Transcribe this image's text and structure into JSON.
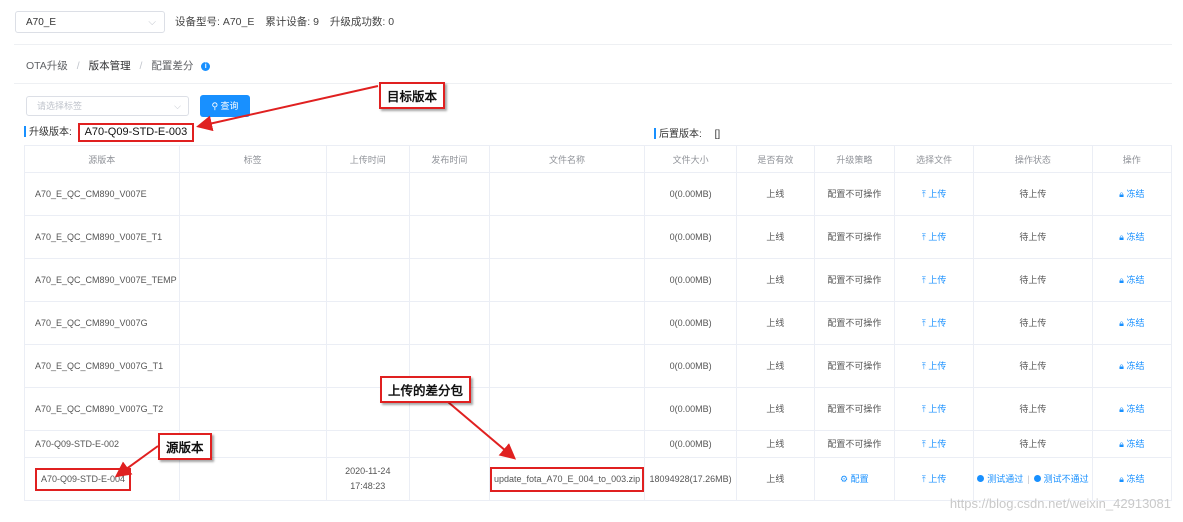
{
  "topbar": {
    "device_select": "A70_E",
    "device_model": "设备型号: A70_E",
    "total_devices": "累计设备: 9",
    "upgrade_success": "升级成功数: 0"
  },
  "breadcrumb": [
    "OTA升级",
    "版本管理",
    "配置差分"
  ],
  "filter": {
    "tag_placeholder": "请选择标签",
    "query_label": "查询"
  },
  "upgrade_version": {
    "label": "升级版本:",
    "value": "A70-Q09-STD-E-003"
  },
  "post_version": {
    "label": "后置版本:",
    "value": "[]"
  },
  "table": {
    "headers": [
      "源版本",
      "标签",
      "上传时间",
      "发布时间",
      "文件名称",
      "文件大小",
      "是否有效",
      "升级策略",
      "选择文件",
      "操作状态",
      "操作"
    ],
    "rows": [
      {
        "src": "A70_E_QC_CM890_V007E",
        "tag": "",
        "upload_time": "",
        "publish_time": "",
        "file_name": "",
        "size": "0(0.00MB)",
        "valid": "上线",
        "strategy": "配置不可操作",
        "choose": "上传",
        "status": "待上传",
        "action": "冻结"
      },
      {
        "src": "A70_E_QC_CM890_V007E_T1",
        "tag": "",
        "upload_time": "",
        "publish_time": "",
        "file_name": "",
        "size": "0(0.00MB)",
        "valid": "上线",
        "strategy": "配置不可操作",
        "choose": "上传",
        "status": "待上传",
        "action": "冻结"
      },
      {
        "src": "A70_E_QC_CM890_V007E_TEMP",
        "tag": "",
        "upload_time": "",
        "publish_time": "",
        "file_name": "",
        "size": "0(0.00MB)",
        "valid": "上线",
        "strategy": "配置不可操作",
        "choose": "上传",
        "status": "待上传",
        "action": "冻结"
      },
      {
        "src": "A70_E_QC_CM890_V007G",
        "tag": "",
        "upload_time": "",
        "publish_time": "",
        "file_name": "",
        "size": "0(0.00MB)",
        "valid": "上线",
        "strategy": "配置不可操作",
        "choose": "上传",
        "status": "待上传",
        "action": "冻结"
      },
      {
        "src": "A70_E_QC_CM890_V007G_T1",
        "tag": "",
        "upload_time": "",
        "publish_time": "",
        "file_name": "",
        "size": "0(0.00MB)",
        "valid": "上线",
        "strategy": "配置不可操作",
        "choose": "上传",
        "status": "待上传",
        "action": "冻结"
      },
      {
        "src": "A70_E_QC_CM890_V007G_T2",
        "tag": "",
        "upload_time": "",
        "publish_time": "",
        "file_name": "",
        "size": "0(0.00MB)",
        "valid": "上线",
        "strategy": "配置不可操作",
        "choose": "上传",
        "status": "待上传",
        "action": "冻结"
      },
      {
        "src": "A70-Q09-STD-E-002",
        "tag": "",
        "upload_time": "",
        "publish_time": "",
        "file_name": "",
        "size": "0(0.00MB)",
        "valid": "上线",
        "strategy": "配置不可操作",
        "choose": "上传",
        "status": "待上传",
        "action": "冻结"
      }
    ],
    "last_row": {
      "src": "A70-Q09-STD-E-004",
      "upload_time": "2020-11-24 17:48:23",
      "file_name": "update_fota_A70_E_004_to_003.zip",
      "size": "18094928(17.26MB)",
      "valid": "上线",
      "strategy": "配置",
      "choose": "上传",
      "status_pass": "测试通过",
      "status_fail": "测试不通过",
      "action": "冻结"
    }
  },
  "callouts": {
    "target": "目标版本",
    "uploaded": "上传的差分包",
    "source": "源版本"
  },
  "watermark": "https://blog.csdn.net/weixin_42913081",
  "colors": {
    "accent": "#1890ff",
    "annotation": "#e02020"
  }
}
